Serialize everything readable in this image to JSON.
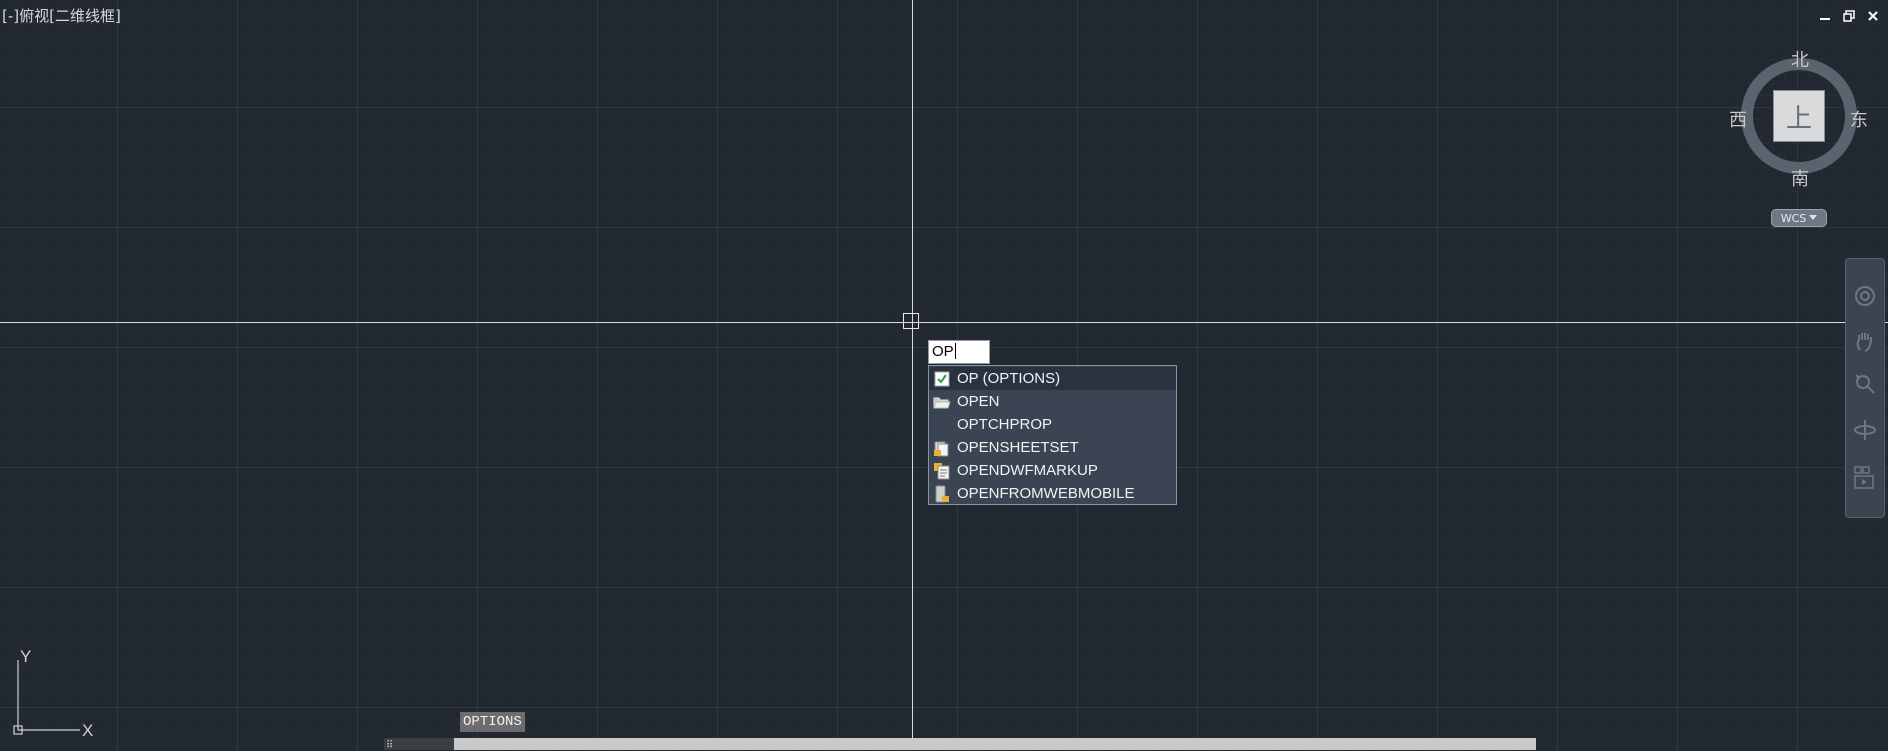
{
  "viewport": {
    "label": "[-]俯视[二维线框]"
  },
  "window_controls": {
    "minimize_icon": "minimize-icon",
    "restore_icon": "restore-icon",
    "close_icon": "close-icon"
  },
  "command": {
    "input_value": "OP",
    "autocomplete": [
      {
        "label": "OP (OPTIONS)",
        "icon": "checkbox-icon",
        "selected": true
      },
      {
        "label": "OPEN",
        "icon": "folder-open-icon"
      },
      {
        "label": "OPTCHPROP",
        "icon": ""
      },
      {
        "label": "OPENSHEETSET",
        "icon": "sheetset-icon"
      },
      {
        "label": "OPENDWFMARKUP",
        "icon": "dwf-markup-icon"
      },
      {
        "label": "OPENFROMWEBMOBILE",
        "icon": "web-mobile-icon"
      }
    ],
    "tooltip": "OPTIONS"
  },
  "viewcube": {
    "north": "北",
    "south": "南",
    "east": "东",
    "west": "西",
    "face": "上",
    "wcs_label": "WCS"
  },
  "ucs": {
    "x_label": "X",
    "y_label": "Y"
  },
  "colors": {
    "background": "#212830",
    "grid_major": "#2e3743",
    "crosshair": "#d9d9d9",
    "autocomplete_bg": "#3b4453"
  }
}
